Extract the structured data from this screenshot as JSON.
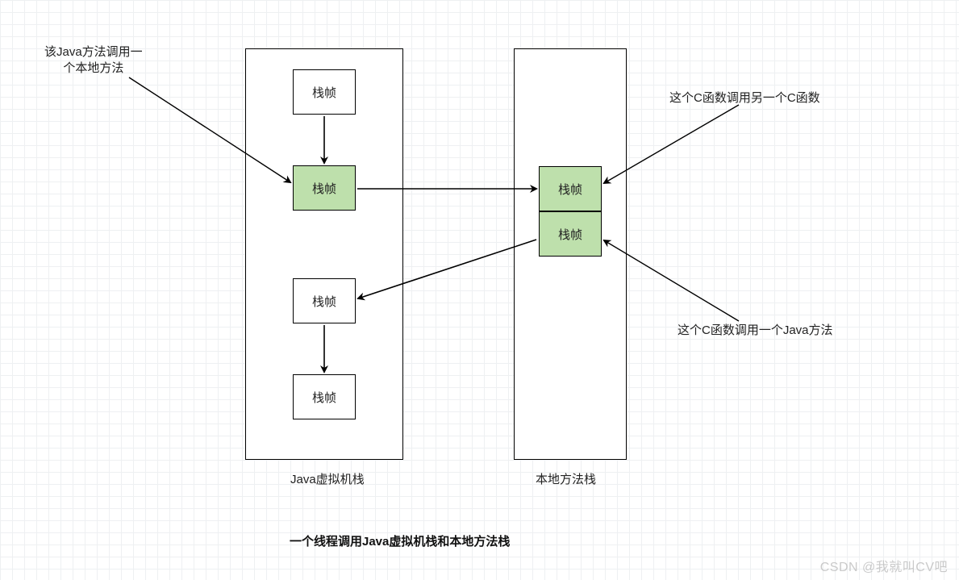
{
  "annotations": {
    "left_note": "该Java方法调用一\n个本地方法",
    "right_note_1": "这个C函数调用另一个C函数",
    "right_note_2": "这个C函数调用一个Java方法"
  },
  "stacks": {
    "jvm": {
      "label": "Java虚拟机栈",
      "frames": [
        "栈帧",
        "栈帧",
        "栈帧",
        "栈帧"
      ]
    },
    "native": {
      "label": "本地方法栈",
      "frames": [
        "栈帧",
        "栈帧"
      ]
    }
  },
  "caption": "一个线程调用Java虚拟机栈和本地方法栈",
  "watermark": "CSDN @我就叫CV吧"
}
